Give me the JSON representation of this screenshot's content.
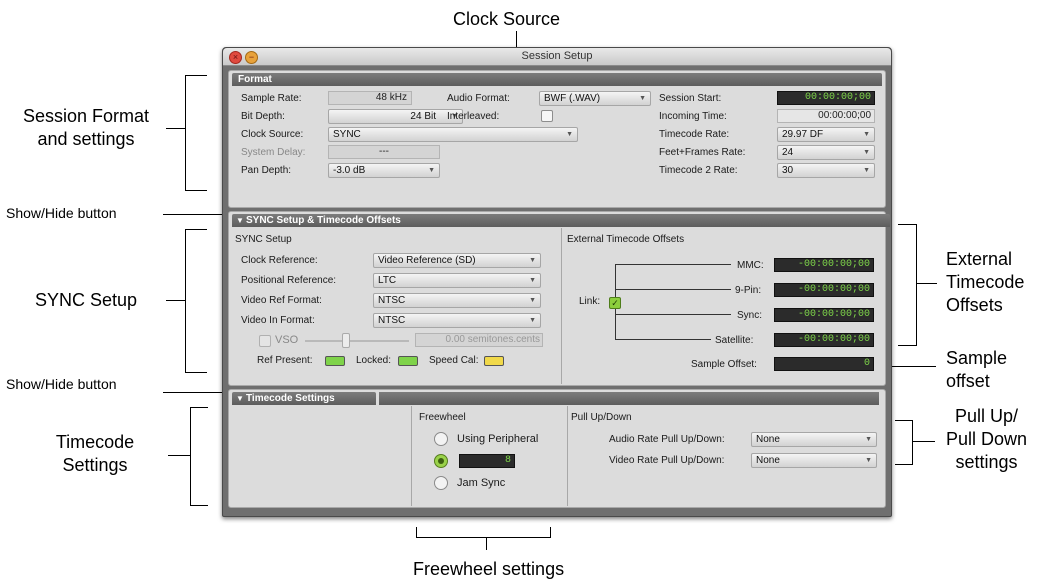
{
  "callouts": {
    "clock_source": "Clock Source",
    "session_format_line1": "Session Format",
    "session_format_line2": "and settings",
    "show_hide_1": "Show/Hide button",
    "sync_setup": "SYNC Setup",
    "external_tc_line1": "External",
    "external_tc_line2": "Timecode",
    "external_tc_line3": "Offsets",
    "sample_offset_line1": "Sample",
    "sample_offset_line2": "offset",
    "show_hide_2": "Show/Hide button",
    "timecode_settings_line1": "Timecode",
    "timecode_settings_line2": "Settings",
    "pull_line1": "Pull Up/",
    "pull_line2": "Pull Down",
    "pull_line3": "settings",
    "freewheel_settings": "Freewheel settings"
  },
  "window": {
    "title": "Session Setup"
  },
  "format": {
    "header": "Format",
    "sample_rate_label": "Sample Rate:",
    "sample_rate_value": "48 kHz",
    "audio_format_label": "Audio Format:",
    "audio_format_value": "BWF (.WAV)",
    "session_start_label": "Session Start:",
    "session_start_value": "00:00:00;00",
    "bit_depth_label": "Bit Depth:",
    "bit_depth_value": "24 Bit",
    "interleaved_label": "Interleaved:",
    "incoming_time_label": "Incoming Time:",
    "incoming_time_value": "00:00:00;00",
    "clock_source_label": "Clock Source:",
    "clock_source_value": "SYNC",
    "timecode_rate_label": "Timecode Rate:",
    "timecode_rate_value": "29.97 DF",
    "system_delay_label": "System Delay:",
    "system_delay_value": "---",
    "feet_frames_label": "Feet+Frames Rate:",
    "feet_frames_value": "24",
    "pan_depth_label": "Pan Depth:",
    "pan_depth_value": "-3.0 dB",
    "timecode2_label": "Timecode 2 Rate:",
    "timecode2_value": "30"
  },
  "sync": {
    "header": "SYNC Setup & Timecode Offsets",
    "setup_title": "SYNC Setup",
    "clock_ref_label": "Clock Reference:",
    "clock_ref_value": "Video Reference (SD)",
    "positional_ref_label": "Positional Reference:",
    "positional_ref_value": "LTC",
    "video_ref_format_label": "Video Ref Format:",
    "video_ref_format_value": "NTSC",
    "video_in_format_label": "Video In Format:",
    "video_in_format_value": "NTSC",
    "vso_label": "VSO",
    "vso_value": "0.00  semitones.cents",
    "ref_present_label": "Ref Present:",
    "locked_label": "Locked:",
    "speed_cal_label": "Speed Cal:",
    "offsets_title": "External Timecode Offsets",
    "mmc_label": "MMC:",
    "mmc_value": "-00:00:00;00",
    "ninepin_label": "9-Pin:",
    "ninepin_value": "-00:00:00;00",
    "sync_label": "Sync:",
    "sync_value": "-00:00:00;00",
    "satellite_label": "Satellite:",
    "satellite_value": "-00:00:00;00",
    "link_label": "Link:",
    "sample_offset_label": "Sample Offset:",
    "sample_offset_value": "0",
    "colors": {
      "led_green": "#7fd34a",
      "led_yellow": "#f1d94a"
    }
  },
  "timecode": {
    "header": "Timecode Settings",
    "freewheel_title": "Freewheel",
    "using_peripheral_label": "Using Peripheral",
    "frames_value": "8",
    "jam_sync_label": "Jam Sync",
    "pull_title": "Pull Up/Down",
    "audio_pull_label": "Audio Rate Pull Up/Down:",
    "audio_pull_value": "None",
    "video_pull_label": "Video Rate Pull Up/Down:",
    "video_pull_value": "None"
  }
}
